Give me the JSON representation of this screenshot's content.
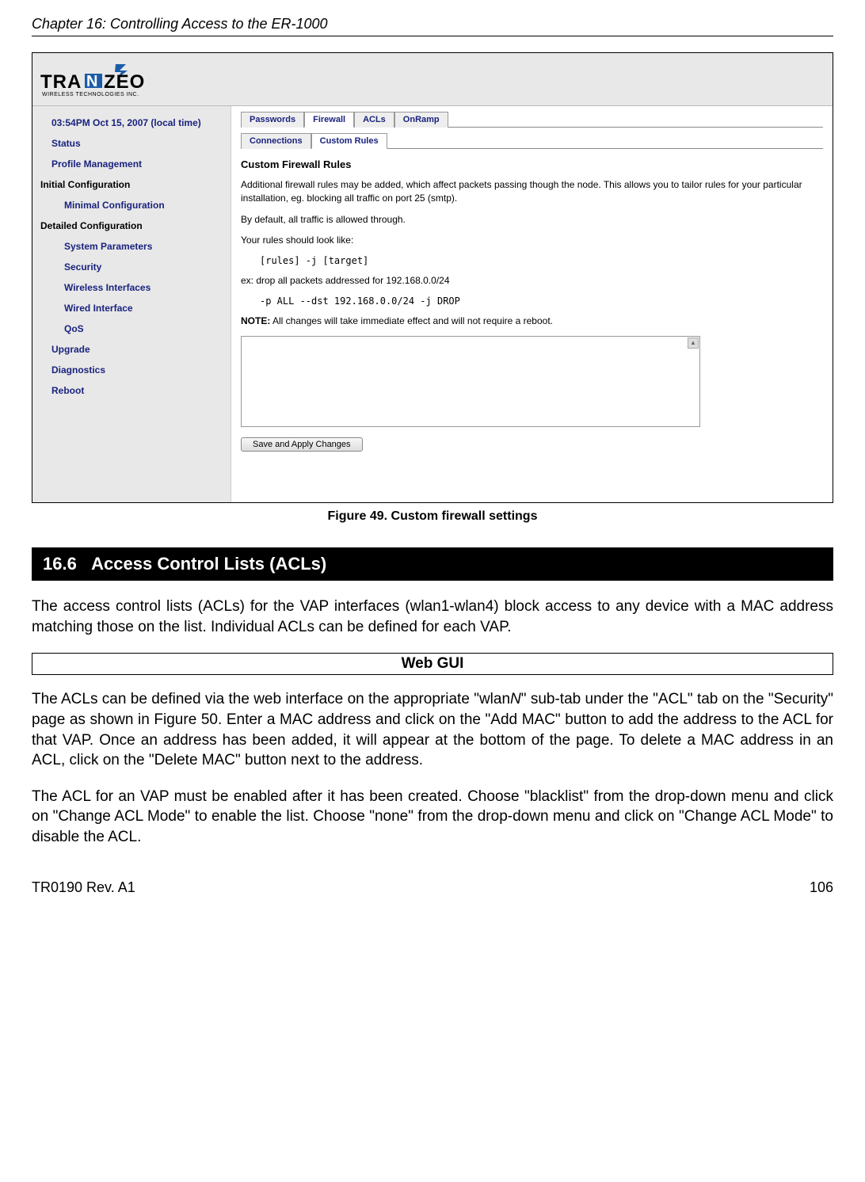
{
  "chapter_header": "Chapter 16: Controlling Access to the ER-1000",
  "logo": {
    "text": "TRANZEO",
    "subtitle": "WIRELESS TECHNOLOGIES INC."
  },
  "sidebar": {
    "items": [
      {
        "label": "03:54PM Oct 15, 2007 (local time)",
        "level": "l2"
      },
      {
        "label": "Status",
        "level": "l2"
      },
      {
        "label": "Profile Management",
        "level": "l2"
      },
      {
        "label": "Initial Configuration",
        "level": "l1"
      },
      {
        "label": "Minimal Configuration",
        "level": "l3"
      },
      {
        "label": "Detailed Configuration",
        "level": "l1"
      },
      {
        "label": "System Parameters",
        "level": "l3"
      },
      {
        "label": "Security",
        "level": "l3"
      },
      {
        "label": "Wireless Interfaces",
        "level": "l3"
      },
      {
        "label": "Wired Interface",
        "level": "l3"
      },
      {
        "label": "QoS",
        "level": "l3"
      },
      {
        "label": "Upgrade",
        "level": "l2"
      },
      {
        "label": "Diagnostics",
        "level": "l2"
      },
      {
        "label": "Reboot",
        "level": "l2"
      }
    ]
  },
  "tabs_primary": [
    {
      "label": "Passwords",
      "active": false
    },
    {
      "label": "Firewall",
      "active": true
    },
    {
      "label": "ACLs",
      "active": false
    },
    {
      "label": "OnRamp",
      "active": false
    }
  ],
  "tabs_secondary": [
    {
      "label": "Connections",
      "active": false
    },
    {
      "label": "Custom Rules",
      "active": true
    }
  ],
  "content": {
    "title": "Custom Firewall Rules",
    "p1": "Additional firewall rules may be added, which affect packets passing though the node. This allows you to tailor rules for your particular installation, eg. blocking all traffic on port 25 (smtp).",
    "p2": "By default, all traffic is allowed through.",
    "p3": "Your rules should look like:",
    "code1": "[rules] -j [target]",
    "p4": "ex: drop all packets addressed for 192.168.0.0/24",
    "code2": "-p ALL --dst 192.168.0.0/24 -j DROP",
    "note_label": "NOTE:",
    "note_text": " All changes will take immediate effect and will not require a reboot.",
    "save_btn": "Save and Apply Changes"
  },
  "figure_caption": "Figure 49. Custom firewall settings",
  "section": {
    "number": "16.6",
    "title": "Access Control Lists (ACLs)"
  },
  "doc": {
    "p1": "The access control lists (ACLs) for the VAP interfaces (wlan1-wlan4) block access to any device with a MAC address matching those on the list. Individual ACLs can be defined for each VAP.",
    "webgui": "Web GUI",
    "p2a": "The ACLs can be defined via the web interface on the appropriate \"wlan",
    "p2n": "N",
    "p2b": "\" sub-tab under the \"ACL\" tab on the \"Security\" page as shown in Figure 50. Enter a MAC address and click on the \"Add MAC\" button to add the address to the ACL for that VAP. Once an address has been added, it will appear at the bottom of the page. To delete a MAC address in an ACL, click on the \"Delete MAC\" button next to the address.",
    "p3": "The ACL for an VAP must be enabled after it has been created. Choose \"blacklist\" from the drop-down menu and click on \"Change ACL Mode\" to enable the list. Choose \"none\" from the drop-down menu and click on \"Change ACL Mode\" to disable the ACL."
  },
  "footer": {
    "left": "TR0190 Rev. A1",
    "right": "106"
  }
}
